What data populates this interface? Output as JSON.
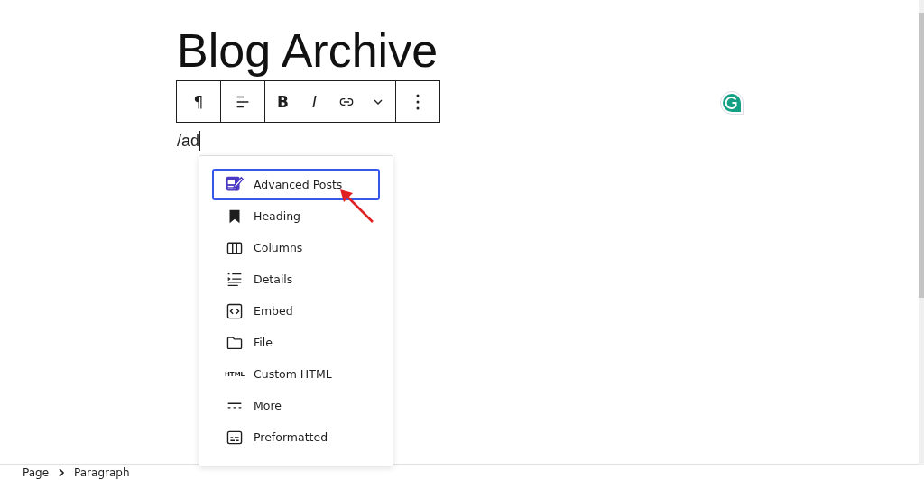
{
  "title": "Blog Archive",
  "toolbar": {
    "groups": [
      [
        {
          "kind": "text",
          "label": "¶"
        }
      ],
      [
        {
          "kind": "align"
        }
      ],
      [
        {
          "kind": "bold",
          "label": "B"
        },
        {
          "kind": "italic",
          "label": "I"
        },
        {
          "kind": "link"
        },
        {
          "kind": "chevron"
        }
      ],
      [
        {
          "kind": "more"
        }
      ]
    ]
  },
  "typed_text": "/ad",
  "inserter": {
    "items": [
      {
        "kind": "advanced",
        "label": "Advanced Posts",
        "selected": true
      },
      {
        "kind": "heading",
        "label": "Heading",
        "selected": false
      },
      {
        "kind": "columns",
        "label": "Columns",
        "selected": false
      },
      {
        "kind": "details",
        "label": "Details",
        "selected": false
      },
      {
        "kind": "embed",
        "label": "Embed",
        "selected": false
      },
      {
        "kind": "file",
        "label": "File",
        "selected": false
      },
      {
        "kind": "html",
        "icon_text": "HTML",
        "label": "Custom HTML",
        "selected": false
      },
      {
        "kind": "more",
        "label": "More",
        "selected": false
      },
      {
        "kind": "preformatted",
        "label": "Preformatted",
        "selected": false
      }
    ]
  },
  "breadcrumb": [
    "Page",
    "Paragraph"
  ]
}
